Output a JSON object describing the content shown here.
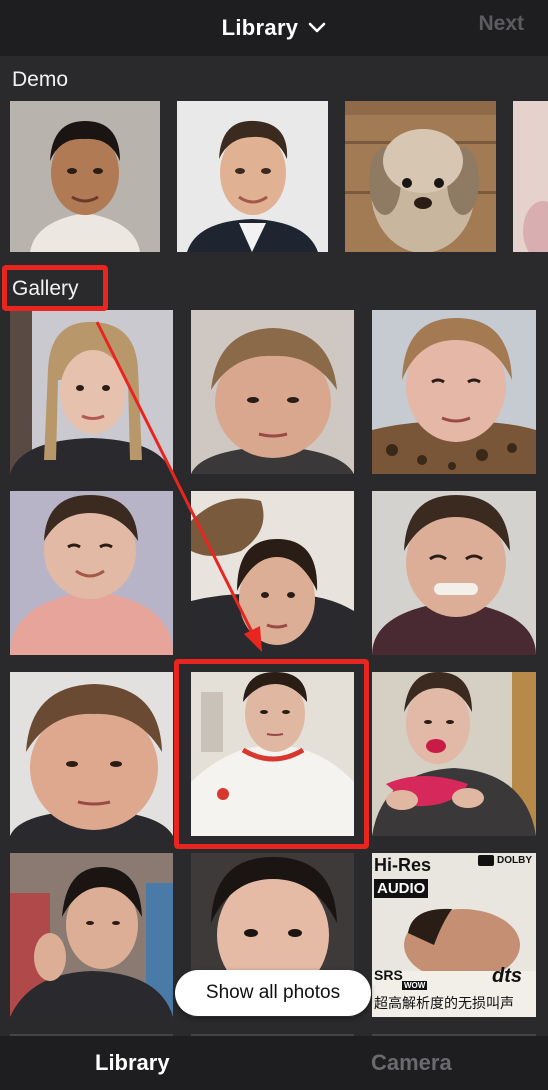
{
  "header": {
    "title": "Library",
    "next_label": "Next"
  },
  "sections": {
    "demo_label": "Demo",
    "gallery_label": "Gallery"
  },
  "demo_thumbs": [
    {
      "name": "demo-photo-man-1"
    },
    {
      "name": "demo-photo-man-2"
    },
    {
      "name": "demo-photo-dog"
    },
    {
      "name": "demo-photo-partial"
    }
  ],
  "gallery_thumbs": [
    {
      "name": "gallery-photo-1"
    },
    {
      "name": "gallery-photo-2"
    },
    {
      "name": "gallery-photo-3"
    },
    {
      "name": "gallery-photo-4"
    },
    {
      "name": "gallery-photo-5"
    },
    {
      "name": "gallery-photo-6"
    },
    {
      "name": "gallery-photo-7"
    },
    {
      "name": "gallery-photo-8"
    },
    {
      "name": "gallery-photo-9"
    },
    {
      "name": "gallery-photo-10"
    },
    {
      "name": "gallery-photo-11"
    },
    {
      "name": "gallery-photo-12"
    }
  ],
  "video_thumb_labels": {
    "hires": "Hi-Res",
    "audio": "AUDIO",
    "dolby": "DOLBY",
    "dts": "dts",
    "srs": "SRS",
    "wow": "WOW",
    "caption": "超高解析度的无损叫声"
  },
  "show_all_label": "Show all photos",
  "tabs": {
    "library": "Library",
    "camera": "Camera"
  },
  "colors": {
    "highlight": "#e8261f",
    "background": "#2a2a2c"
  }
}
